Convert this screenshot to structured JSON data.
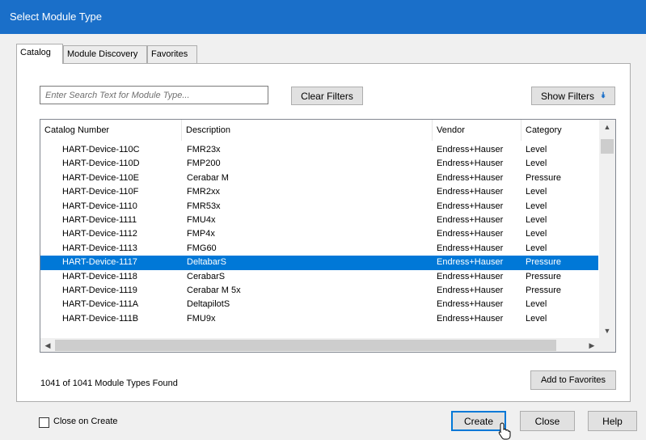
{
  "window": {
    "title": "Select Module Type"
  },
  "tabs": [
    {
      "label": "Catalog",
      "active": true
    },
    {
      "label": "Module Discovery",
      "active": false
    },
    {
      "label": "Favorites",
      "active": false
    }
  ],
  "search": {
    "placeholder": "Enter Search Text for Module Type...",
    "value": ""
  },
  "buttons": {
    "clear_filters": "Clear Filters",
    "show_filters": "Show Filters",
    "add_to_favorites": "Add to Favorites",
    "create": "Create",
    "close": "Close",
    "help": "Help"
  },
  "icons": {
    "show_filters": "chevron-double-down-icon"
  },
  "table": {
    "columns": [
      "Catalog Number",
      "Description",
      "Vendor",
      "Category"
    ],
    "selected_index": 8,
    "rows": [
      {
        "catalog_number": "HART-Device-110C",
        "description": "FMR23x",
        "vendor": "Endress+Hauser",
        "category": "Level"
      },
      {
        "catalog_number": "HART-Device-110D",
        "description": "FMP200",
        "vendor": "Endress+Hauser",
        "category": "Level"
      },
      {
        "catalog_number": "HART-Device-110E",
        "description": "Cerabar M",
        "vendor": "Endress+Hauser",
        "category": "Pressure"
      },
      {
        "catalog_number": "HART-Device-110F",
        "description": "FMR2xx",
        "vendor": "Endress+Hauser",
        "category": "Level"
      },
      {
        "catalog_number": "HART-Device-1110",
        "description": "FMR53x",
        "vendor": "Endress+Hauser",
        "category": "Level"
      },
      {
        "catalog_number": "HART-Device-1111",
        "description": "FMU4x",
        "vendor": "Endress+Hauser",
        "category": "Level"
      },
      {
        "catalog_number": "HART-Device-1112",
        "description": "FMP4x",
        "vendor": "Endress+Hauser",
        "category": "Level"
      },
      {
        "catalog_number": "HART-Device-1113",
        "description": "FMG60",
        "vendor": "Endress+Hauser",
        "category": "Level"
      },
      {
        "catalog_number": "HART-Device-1117",
        "description": "DeltabarS",
        "vendor": "Endress+Hauser",
        "category": "Pressure"
      },
      {
        "catalog_number": "HART-Device-1118",
        "description": "CerabarS",
        "vendor": "Endress+Hauser",
        "category": "Pressure"
      },
      {
        "catalog_number": "HART-Device-1119",
        "description": "Cerabar M 5x",
        "vendor": "Endress+Hauser",
        "category": "Pressure"
      },
      {
        "catalog_number": "HART-Device-111A",
        "description": "DeltapilotS",
        "vendor": "Endress+Hauser",
        "category": "Level"
      },
      {
        "catalog_number": "HART-Device-111B",
        "description": "FMU9x",
        "vendor": "Endress+Hauser",
        "category": "Level"
      }
    ]
  },
  "status": {
    "found_text": "1041 of 1041 Module Types Found"
  },
  "close_on_create": {
    "label": "Close on Create",
    "checked": false
  },
  "colors": {
    "titlebar": "#1a6fc9",
    "selection": "#0078d7",
    "dialog_bg": "#f0f0f0"
  }
}
